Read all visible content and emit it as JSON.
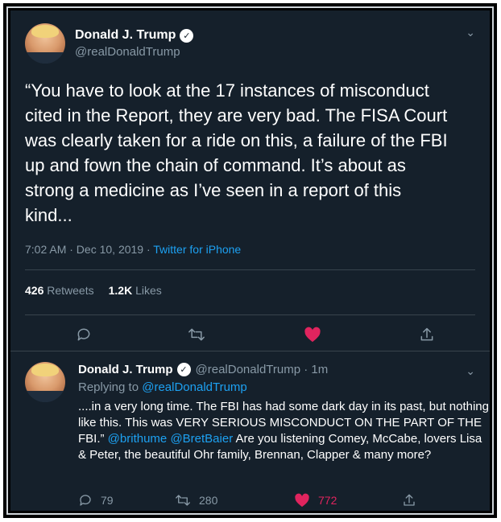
{
  "main_tweet": {
    "display_name": "Donald J. Trump",
    "handle": "@realDonaldTrump",
    "text": "“You have to look at the 17 instances of misconduct\ncited in the Report, they are very bad. The FISA Court\nwas clearly taken for a ride on this, a failure of the FBI\nup and fown the chain of command. It’s about as\nstrong a medicine as I’ve seen in a report of this\nkind...",
    "time": "7:02 AM · Dec 10, 2019 · ",
    "source": "Twitter for iPhone",
    "retweets_count": "426",
    "retweets_label": "Retweets",
    "likes_count": "1.2K",
    "likes_label": "Likes"
  },
  "reply_tweet": {
    "display_name": "Donald J. Trump",
    "handle_time": "@realDonaldTrump · 1m",
    "replying_label": "Replying to ",
    "replying_handle": "@realDonaldTrump",
    "text_part1": "....in a very long time. The FBI has had some dark day in its past, but nothing like this. This was VERY SERIOUS MISCONDUCT ON THE PART OF THE FBI.” ",
    "mention1": "@brithume",
    "mention2": "@BretBaier",
    "text_part2": "  Are you listening Comey, McCabe, lovers Lisa & Peter, the beautiful Ohr family, Brennan, Clapper & many more?",
    "reply_count": "79",
    "retweet_count": "280",
    "like_count": "772"
  },
  "icons": {
    "verified": "verified-badge-icon",
    "chevron": "chevron-down-icon",
    "reply": "reply-icon",
    "retweet": "retweet-icon",
    "like": "heart-icon",
    "share": "share-icon"
  },
  "colors": {
    "background": "#15202b",
    "text": "#ffffff",
    "muted": "#8899a6",
    "link": "#1da1f2",
    "like": "#e0245e",
    "divider": "#38444d"
  }
}
